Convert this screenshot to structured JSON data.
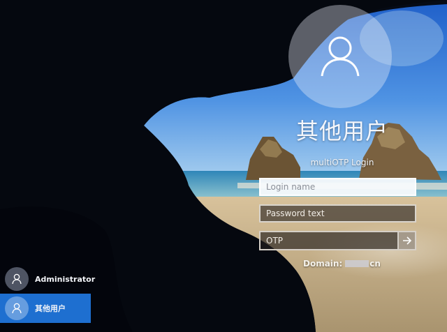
{
  "account": {
    "heading": "其他用户",
    "avatar_icon": "user-silhouette-icon"
  },
  "login_form": {
    "provider_title": "multiOTP Login",
    "login_name_placeholder": "Login name",
    "password_placeholder": "Password text",
    "otp_placeholder": "OTP",
    "submit_icon": "arrow-right-icon",
    "domain_label": "Domain:",
    "domain_suffix": "cn"
  },
  "user_list": {
    "items": [
      {
        "label": "Administrator",
        "icon": "user-silhouette-icon",
        "selected": false
      },
      {
        "label": "其他用户",
        "icon": "user-silhouette-icon",
        "selected": true
      }
    ],
    "selected_color": "#1e6fd0"
  }
}
